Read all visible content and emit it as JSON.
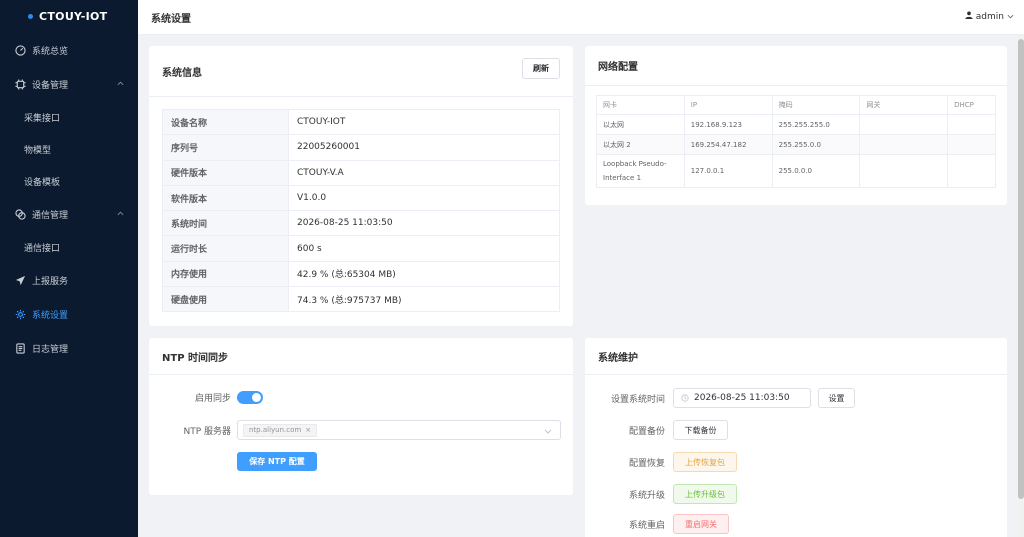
{
  "brand": "CTOUY-IOT",
  "sidebar": {
    "items": [
      {
        "label": "系统总览",
        "icon": "dashboard-icon"
      },
      {
        "label": "设备管理",
        "icon": "device-icon"
      },
      {
        "label": "采集接口"
      },
      {
        "label": "物模型"
      },
      {
        "label": "设备模板"
      },
      {
        "label": "通信管理",
        "icon": "link-icon"
      },
      {
        "label": "通信接口"
      },
      {
        "label": "上报服务",
        "icon": "send-icon"
      },
      {
        "label": "系统设置",
        "icon": "gear-icon"
      },
      {
        "label": "日志管理",
        "icon": "document-icon"
      }
    ]
  },
  "header": {
    "title": "系统设置",
    "user": "admin"
  },
  "sysinfo": {
    "title": "系统信息",
    "refresh": "刷新",
    "rows": [
      {
        "k": "设备名称",
        "v": "CTOUY-IOT"
      },
      {
        "k": "序列号",
        "v": "22005260001"
      },
      {
        "k": "硬件版本",
        "v": "CTOUY-V.A"
      },
      {
        "k": "软件版本",
        "v": "V1.0.0"
      },
      {
        "k": "系统时间",
        "v": "2026-08-25 11:03:50"
      },
      {
        "k": "运行时长",
        "v": "600 s"
      },
      {
        "k": "内存使用",
        "v": "42.9 % (总:65304 MB)"
      },
      {
        "k": "硬盘使用",
        "v": "74.3 % (总:975737 MB)"
      }
    ]
  },
  "network": {
    "title": "网络配置",
    "columns": [
      "网卡",
      "IP",
      "掩码",
      "网关",
      "DHCP"
    ],
    "rows": [
      [
        "以太网",
        "192.168.9.123",
        "255.255.255.0",
        "",
        ""
      ],
      [
        "以太网 2",
        "169.254.47.182",
        "255.255.0.0",
        "",
        ""
      ],
      [
        "Loopback Pseudo-Interface 1",
        "127.0.0.1",
        "255.0.0.0",
        "",
        ""
      ]
    ]
  },
  "ntp": {
    "title": "NTP 时间同步",
    "enable_label": "启用同步",
    "enabled": true,
    "server_label": "NTP 服务器",
    "server_tag": "ntp.aliyun.com",
    "save": "保存 NTP 配置"
  },
  "maintain": {
    "title": "系统维护",
    "set_time_label": "设置系统时间",
    "time_value": "2026-08-25 11:03:50",
    "set_btn": "设置",
    "backup_label": "配置备份",
    "backup_btn": "下载备份",
    "restore_label": "配置恢复",
    "restore_btn": "上传恢复包",
    "upgrade_label": "系统升级",
    "upgrade_btn": "上传升级包",
    "reboot_label": "系统重启",
    "reboot_btn": "重启网关"
  },
  "colors": {
    "sidebar_bg": "#0b1a2e",
    "accent": "#409eff"
  }
}
